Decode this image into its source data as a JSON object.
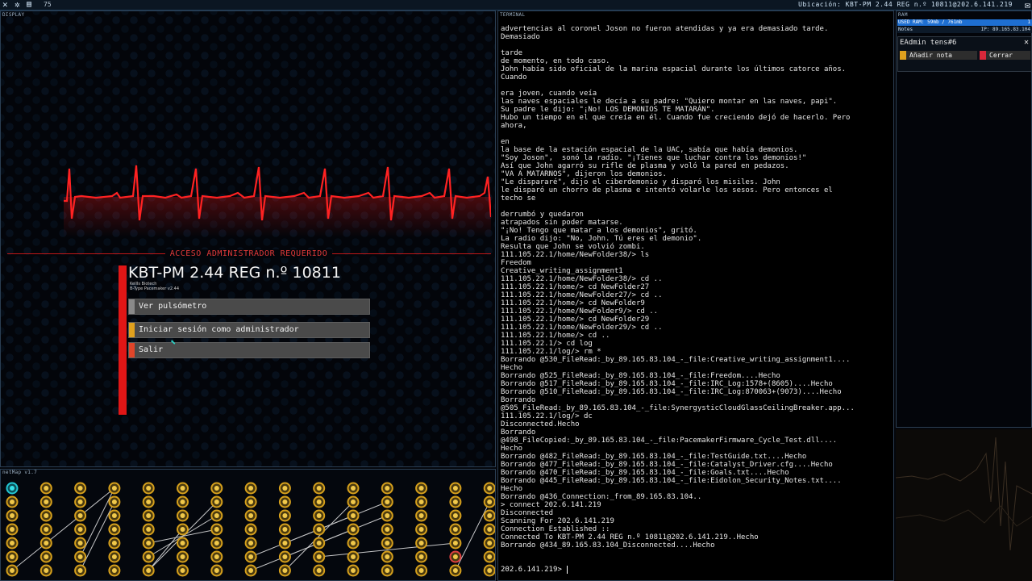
{
  "topbar": {
    "counter": "75",
    "location": "Ubicación: KBT-PM 2.44 REG n.º 10811@202.6.141.219"
  },
  "panels": {
    "display": "DISPLAY",
    "terminal": "TERMINAL",
    "ram": "RAM",
    "netmap": "netMap v1.7"
  },
  "display": {
    "admin_header": "ACCESO ADMINISTRADOR REQUERIDO",
    "system_title": "KBT-PM 2.44 REG n.º 10811",
    "subtitle_1": "KellIs Biotech",
    "subtitle_2": "B-Type Pacemaker v2.44",
    "menu": {
      "monitor": "Ver pulsómetro",
      "login": "Iniciar sesión como administrador",
      "exit": "Salir"
    }
  },
  "ram": {
    "used": "USED RAM: 59mb / 761mb",
    "used_count": "1",
    "notes_label": "Notes",
    "ip": "IP: 89.165.83.104",
    "note_title": "EAdmin tens#6",
    "add_note": "Añadir nota",
    "close": "Cerrar"
  },
  "terminal": {
    "lines": [
      "advertencias al coronel Joson no fueron atendidas y ya era demasiado tarde.",
      "Demasiado",
      "",
      "tarde",
      "de momento, en todo caso.",
      "John había sido oficial de la marina espacial durante los últimos catorce años.",
      "Cuando",
      "",
      "era joven, cuando veía",
      "las naves espaciales le decía a su padre: \"Quiero montar en las naves, papi\".",
      "Su padre le dijo: \"¡No! LOS DEMONIOS TE MATARÁN\".",
      "Hubo un tiempo en el que creía en él. Cuando fue creciendo dejó de hacerlo. Pero",
      "ahora,",
      "",
      "en",
      "la base de la estación espacial de la UAC, sabía que había demonios.",
      "\"Soy Joson\",  sonó la radio. \"¡Tienes que luchar contra los demonios!\"",
      "Así que John agarró su rifle de plasma y voló la pared en pedazos.",
      "\"VA A MATARNOS\", dijeron los demonios.",
      "\"Le dispararé\", dijo el ciberdemonio y disparó los misiles. John",
      "le disparó un chorro de plasma e intentó volarle los sesos. Pero entonces el",
      "techo se",
      "",
      "derrumbó y quedaron",
      "atrapados sin poder matarse.",
      "\"¡No! Tengo que matar a los demonios\", gritó.",
      "La radio dijo: \"No, John. Tú eres el demonio\".",
      "Resulta que John se volvió zombi.",
      "111.105.22.1/home/NewFolder38/> ls",
      "Freedom",
      "Creative_writing_assignment1",
      "111.105.22.1/home/NewFolder38/> cd ..",
      "111.105.22.1/home/> cd NewFolder27",
      "111.105.22.1/home/NewFolder27/> cd ..",
      "111.105.22.1/home/> cd NewFolder9",
      "111.105.22.1/home/NewFolder9/> cd ..",
      "111.105.22.1/home/> cd NewFolder29",
      "111.105.22.1/home/NewFolder29/> cd ..",
      "111.105.22.1/home/> cd ..",
      "111.105.22.1/> cd log",
      "111.105.22.1/log/> rm *",
      "Borrando @530_FileRead:_by_89.165.83.104_-_file:Creative_writing_assignment1....",
      "Hecho",
      "Borrando @525_FileRead:_by_89.165.83.104_-_file:Freedom....Hecho",
      "Borrando @517_FileRead:_by_89.165.83.104_-_file:IRC_Log:1578+(8605)....Hecho",
      "Borrando @510_FileRead:_by_89.165.83.104_-_file:IRC_Log:870063+(9073)....Hecho",
      "Borrando",
      "@505_FileRead:_by_89.165.83.104_-_file:SynergysticCloudGlassCeilingBreaker.app...",
      "111.105.22.1/log/> dc",
      "Disconnected.Hecho",
      "Borrando",
      "@498_FileCopied:_by_89.165.83.104_-_file:PacemakerFirmware_Cycle_Test.dll....",
      "Hecho",
      "Borrando @482_FileRead:_by_89.165.83.104_-_file:TestGuide.txt....Hecho",
      "Borrando @477_FileRead:_by_89.165.83.104_-_file:Catalyst_Driver.cfg....Hecho",
      "Borrando @470_FileRead:_by_89.165.83.104_-_file:Goals.txt....Hecho",
      "Borrando @445_FileRead:_by_89.165.83.104_-_file:Eidolon_Security_Notes.txt....",
      "Hecho",
      "Borrando @436_Connection:_from_89.165.83.104..",
      "> connect 202.6.141.219",
      "Disconnected",
      "Scanning For 202.6.141.219",
      "Connection Established ::",
      "Connected To KBT-PM 2.44 REG n.º 10811@202.6.141.219..Hecho",
      "Borrando @434_89.165.83.104_Disconnected....Hecho"
    ],
    "prompt": "202.6.141.219>"
  },
  "colors": {
    "accent_blue": "#1e6fd2",
    "alert_red": "#e11616",
    "node_gold": "#d6a01c",
    "node_cyan": "#22c7d4"
  },
  "icons": {
    "topbar": [
      "close-icon",
      "settings-icon",
      "save-icon",
      "mail-icon"
    ],
    "cursor": "pointer-cursor-icon"
  }
}
